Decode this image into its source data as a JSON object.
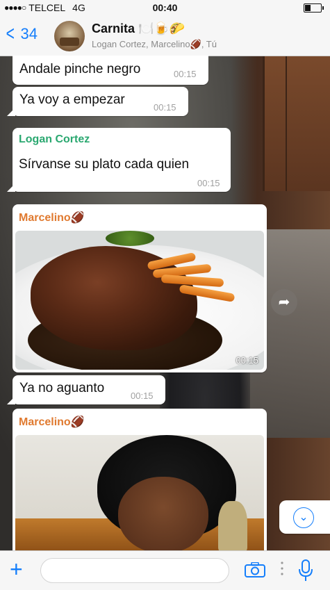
{
  "status_bar": {
    "signal": "●●●●○",
    "carrier": "TELCEL",
    "network": "4G",
    "time": "00:40"
  },
  "header": {
    "back_count": "34",
    "title": "Carnita 🍽️🍺🌮",
    "participants": "Logan Cortez, Marcelino🏈, Tú"
  },
  "messages": [
    {
      "text": "Andale pinche negro",
      "time": "00:15"
    },
    {
      "text": "Ya voy a empezar",
      "time": "00:15"
    },
    {
      "sender": "Logan Cortez",
      "sender_color": "#2aa870",
      "text": "Sírvanse su plato cada quien",
      "time": "00:15"
    },
    {
      "sender": "Marcelino🏈",
      "sender_color": "#e07a30",
      "media": "steak-photo",
      "time": "00:15"
    },
    {
      "text": "Ya no aguanto",
      "time": "00:15"
    },
    {
      "sender": "Marcelino🏈",
      "sender_color": "#e07a30",
      "media": "video-clip"
    }
  ],
  "input": {
    "placeholder": ""
  },
  "icons": {
    "plus": "+",
    "forward": "➦",
    "scroll_down": "⌄"
  },
  "colors": {
    "accent": "#147efb",
    "bubble": "#ffffff"
  }
}
